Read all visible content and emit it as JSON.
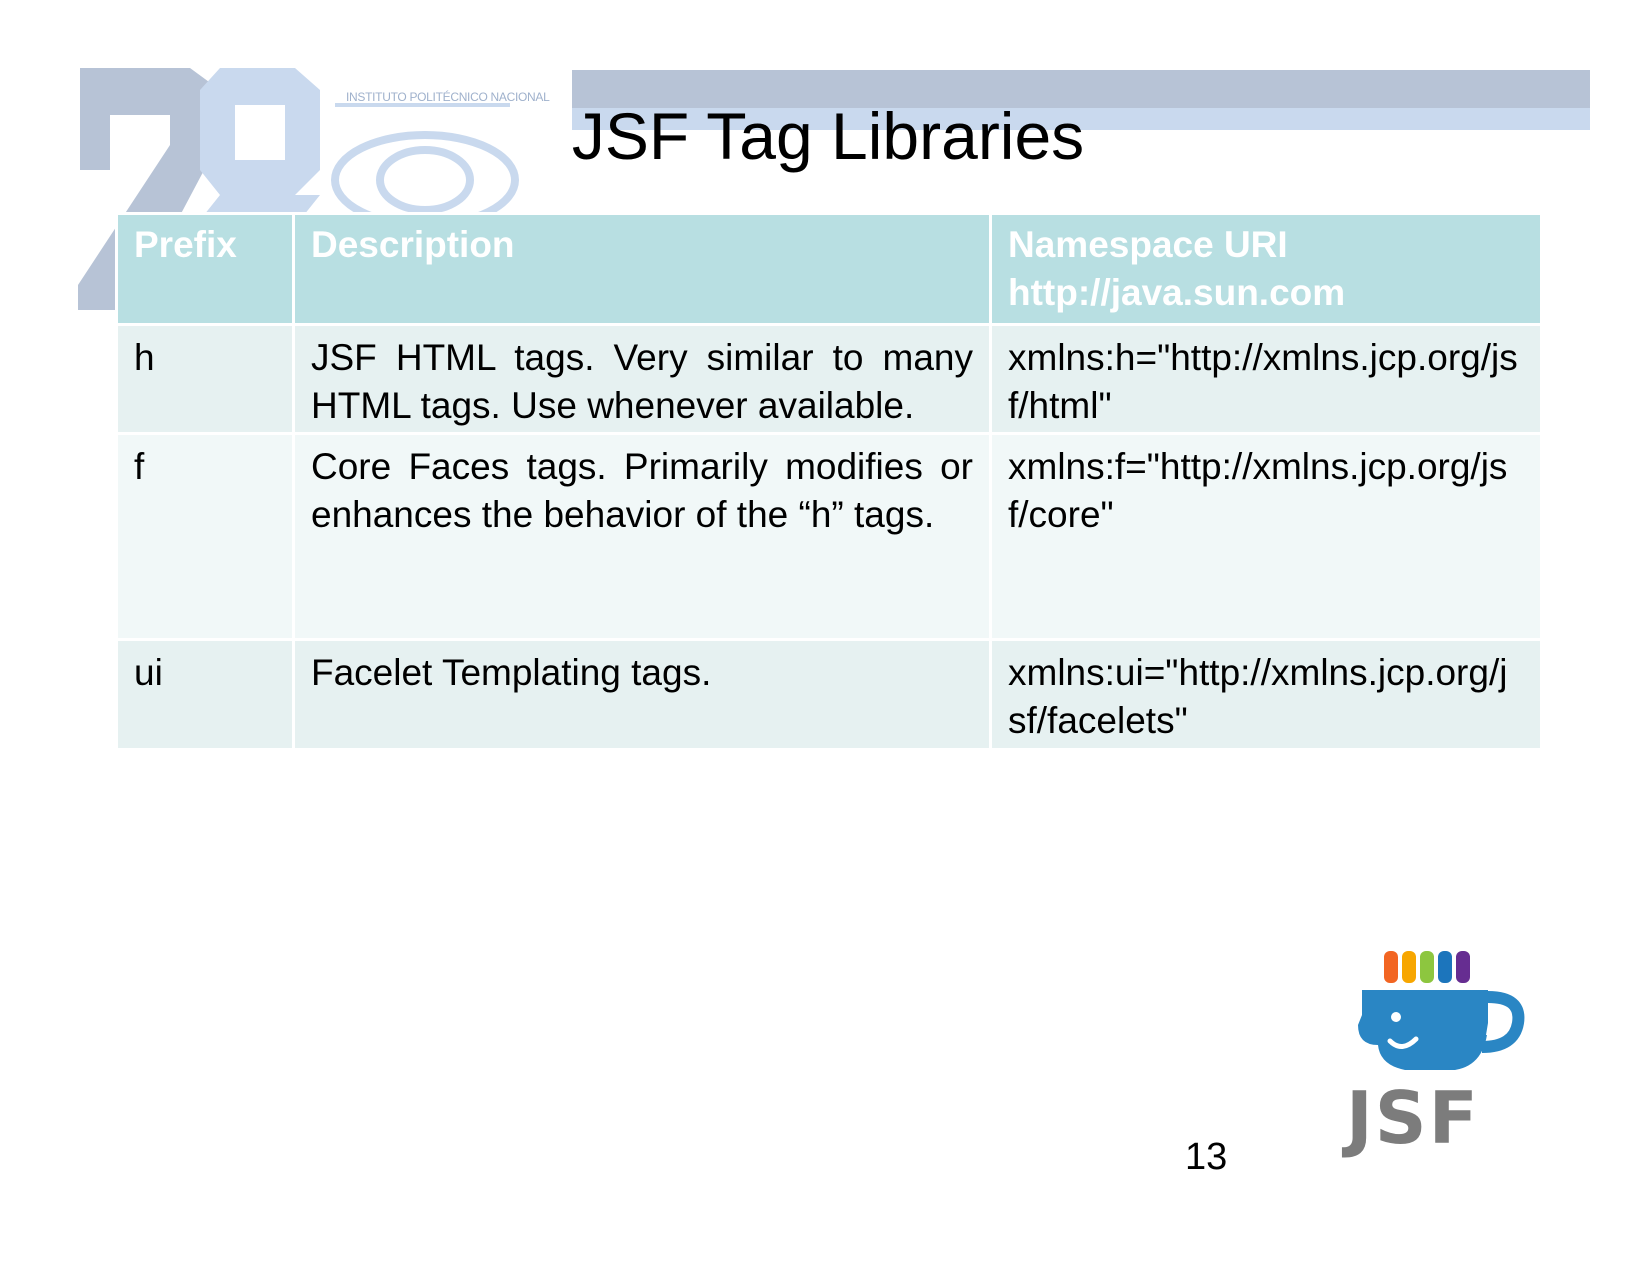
{
  "slide": {
    "title": "JSF Tag Libraries",
    "page_number": "13",
    "watermark_institute": "INSTITUTO POLITÉCNICO NACIONAL",
    "logo_text": "JSF"
  },
  "table": {
    "headers": {
      "prefix": "Prefix",
      "description": "Description",
      "namespace_line1": "Namespace URI",
      "namespace_line2": "http://java.sun.com"
    },
    "rows": [
      {
        "prefix": "h",
        "description": "JSF HTML tags. Very similar to many HTML tags. Use whenever available.",
        "namespace": "xmlns:h=\"http://xmlns.jcp.org/jsf/html\""
      },
      {
        "prefix": "f",
        "description": "Core Faces tags. Primarily modifies or enhances the behavior of the “h” tags.",
        "namespace": "xmlns:f=\"http://xmlns.jcp.org/jsf/core\""
      },
      {
        "prefix": "ui",
        "description": "Facelet Templating tags.",
        "namespace": "xmlns:ui=\"http://xmlns.jcp.org/jsf/facelets\""
      }
    ]
  },
  "colors": {
    "header_bg": "#b8dfe2",
    "row_bg_a": "#e6f1f1",
    "row_bg_b": "#f1f8f8",
    "banner": "#b7c3d6",
    "logo_cup": "#2a86c4",
    "logo_text": "#7c7c7c"
  }
}
